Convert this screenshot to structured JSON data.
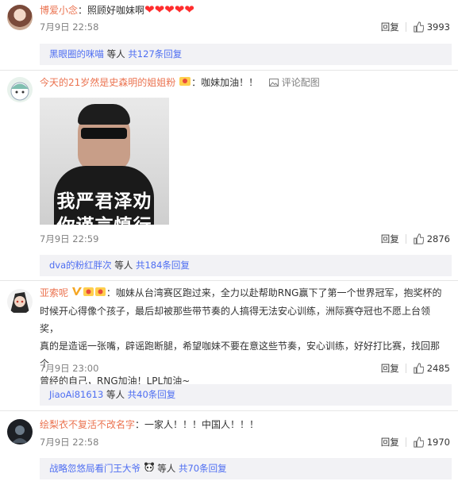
{
  "comments": [
    {
      "username": "博爱小念",
      "text": "：照顾好咖妹啊",
      "hearts": "❤❤❤❤❤",
      "time": "7月9日 22:58",
      "reply_label": "回复",
      "likes": "3993",
      "reply_summary": {
        "user": "黑眼圈的咪喵",
        "mid": " 等人 ",
        "count": "共127条回复"
      }
    },
    {
      "username": "今天的21岁然是史森明的姐姐粉",
      "text": "：咖妹加油！！",
      "report": "评论配图",
      "image_text_1": "我严君泽劝",
      "image_text_2": "你谨言慎行",
      "time": "7月9日 22:59",
      "reply_label": "回复",
      "likes": "2876",
      "reply_summary": {
        "user": "dva的粉红胖次",
        "mid": " 等人 ",
        "count": "共184条回复"
      }
    },
    {
      "username": "亚索呢",
      "text_lines": [
        "：咖妹从台湾赛区跑过来，全力以赴帮助RNG赢下了第一个世界冠军，抱奖杯的",
        "时候开心得像个孩子，最后却被那些带节奏的人搞得无法安心训练，洲际赛夺冠也不愿上台领奖，",
        "真的是造谣一张嘴，辟谣跑断腿，希望咖妹不要在意这些节奏，安心训练，好好打比赛，找回那个",
        "曾经的自己，RNG加油！LPL加油~"
      ],
      "time": "7月9日 23:00",
      "reply_label": "回复",
      "likes": "2485",
      "reply_summary": {
        "user": "JiaoAi81613",
        "mid": " 等人 ",
        "count": "共40条回复"
      }
    },
    {
      "username": "绘梨衣不复活不改名字",
      "text": "：一家人！！！中国人！！！",
      "time": "7月9日 22:58",
      "reply_label": "回复",
      "likes": "1970",
      "reply_summary": {
        "user": "战略忽悠局看门王大爷",
        "mid": " 等人 ",
        "count": "共70条回复"
      }
    }
  ],
  "colors": {
    "username": "#eb7350",
    "link_blue": "#4e6ef2",
    "reply_bg": "#f2f2f5",
    "heart": "#ff2d2d"
  }
}
